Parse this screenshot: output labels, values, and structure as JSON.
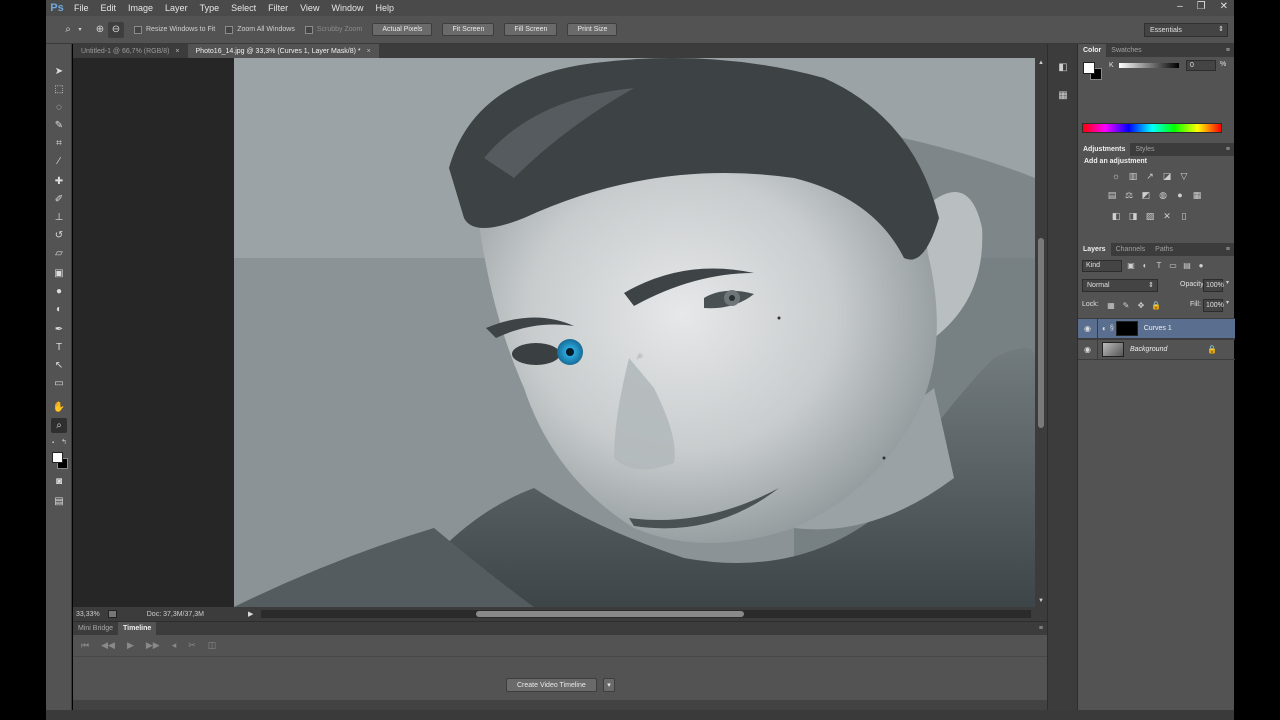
{
  "app": {
    "logo": "Ps",
    "menu": [
      "File",
      "Edit",
      "Image",
      "Layer",
      "Type",
      "Select",
      "Filter",
      "View",
      "Window",
      "Help"
    ],
    "window_controls": [
      "–",
      "❐",
      "✕"
    ]
  },
  "options_bar": {
    "resize_windows": "Resize Windows to Fit",
    "zoom_all": "Zoom All Windows",
    "scrubby_zoom": "Scrubby Zoom",
    "actual_pixels": "Actual Pixels",
    "fit_screen": "Fit Screen",
    "fill_screen": "Fill Screen",
    "print_size": "Print Size",
    "workspace": "Essentials"
  },
  "documents": {
    "tabs": [
      {
        "label": "Untitled-1 @ 66,7% (RGB/8)",
        "active": false
      },
      {
        "label": "Photo16_14.jpg @ 33,3% (Curves 1, Layer Mask/8) *",
        "active": true
      }
    ]
  },
  "status": {
    "zoom": "33,33%",
    "doc_info": "Doc: 37,3M/37,3M"
  },
  "timeline": {
    "tabs": [
      "Mini Bridge",
      "Timeline"
    ],
    "active_tab": "Timeline",
    "create_button": "Create Video Timeline"
  },
  "color_panel": {
    "tabs": [
      "Color",
      "Swatches"
    ],
    "channel_label": "K",
    "value": "0",
    "unit": "%"
  },
  "adjustments_panel": {
    "tabs": [
      "Adjustments",
      "Styles"
    ],
    "title": "Add an adjustment"
  },
  "layers_panel": {
    "tabs": [
      "Layers",
      "Channels",
      "Paths"
    ],
    "filter_kind": "Kind",
    "blend_mode": "Normal",
    "opacity_label": "Opacity:",
    "opacity_value": "100%",
    "lock_label": "Lock:",
    "fill_label": "Fill:",
    "fill_value": "100%",
    "layers": [
      {
        "name": "Curves 1",
        "selected": true
      },
      {
        "name": "Background",
        "selected": false
      }
    ]
  },
  "icons": {
    "zoom_tool": "magnifier-icon",
    "eye": "eye-icon",
    "lock": "lock-icon",
    "panel_menu": "menu-icon"
  },
  "colors": {
    "eye_highlight": "#2a9fd6",
    "selected_layer": "#5a6e8f"
  }
}
